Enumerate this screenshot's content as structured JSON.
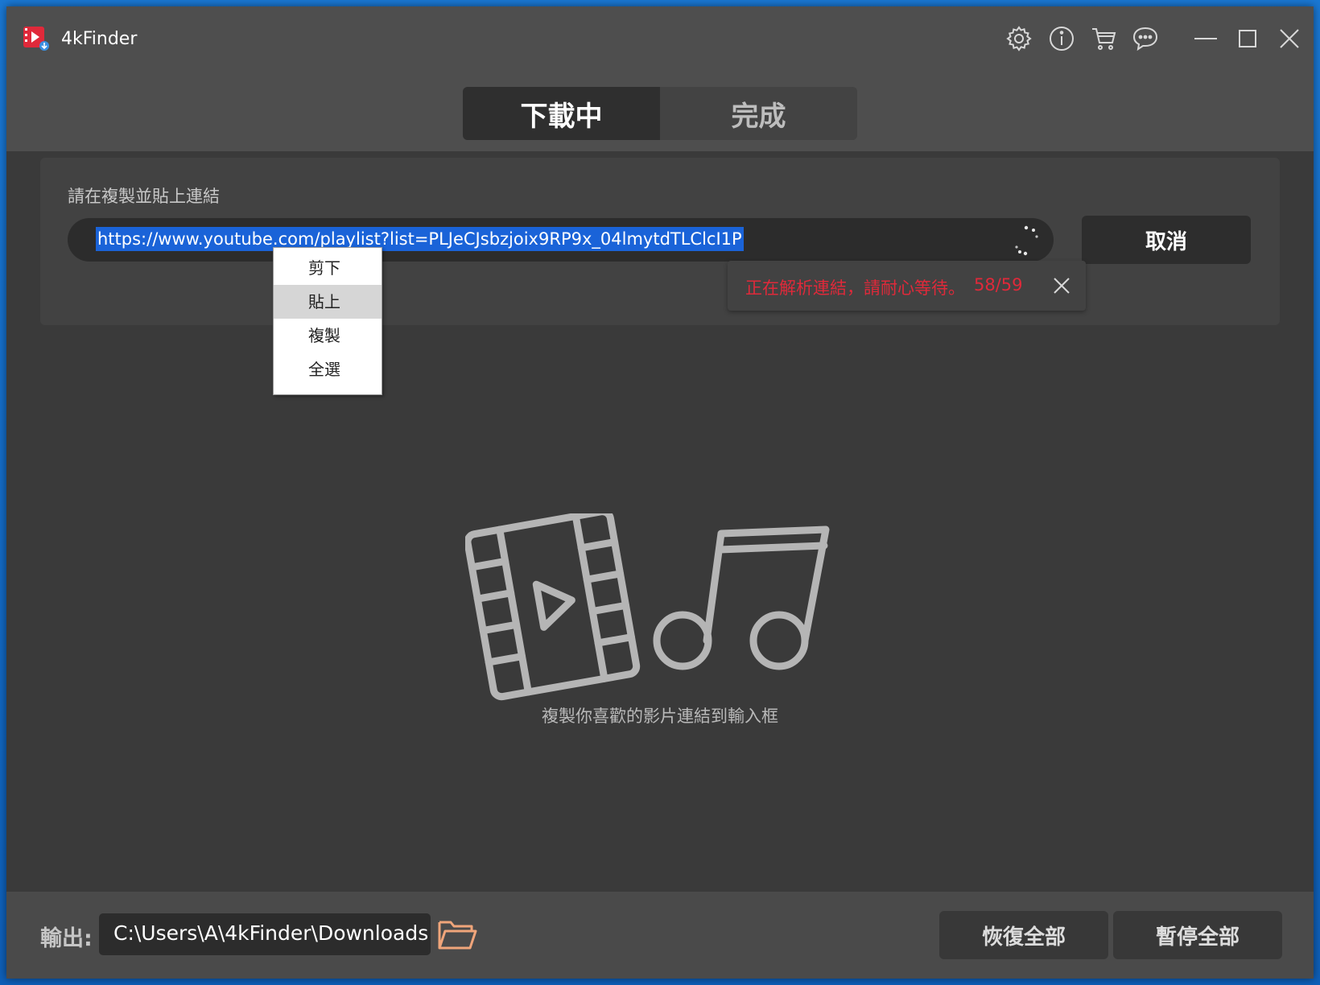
{
  "app": {
    "title": "4kFinder",
    "brand_color": "#e0293a"
  },
  "titlebar": {
    "icons": [
      "gear-icon",
      "info-icon",
      "cart-icon",
      "chat-icon",
      "minimize-icon",
      "maximize-icon",
      "close-icon"
    ]
  },
  "tabs": {
    "downloading": "下載中",
    "finished": "完成",
    "active": "downloading"
  },
  "url_panel": {
    "label": "請在複製並貼上連結",
    "url_value": "https://www.youtube.com/playlist?list=PLJeCJsbzjoix9RP9x_04lmytdTLClcI1P",
    "cancel_label": "取消",
    "status_text": "正在解析連結，請耐心等待。",
    "status_count": "58/59"
  },
  "context_menu": {
    "items": [
      "剪下",
      "貼上",
      "複製",
      "全選"
    ],
    "hovered_index": 1
  },
  "empty_state": {
    "hint": "複製你喜歡的影片連結到輸入框"
  },
  "footer": {
    "output_label": "輸出:",
    "output_path": "C:\\Users\\A\\4kFinder\\Downloads",
    "resume_all": "恢復全部",
    "pause_all": "暫停全部"
  }
}
